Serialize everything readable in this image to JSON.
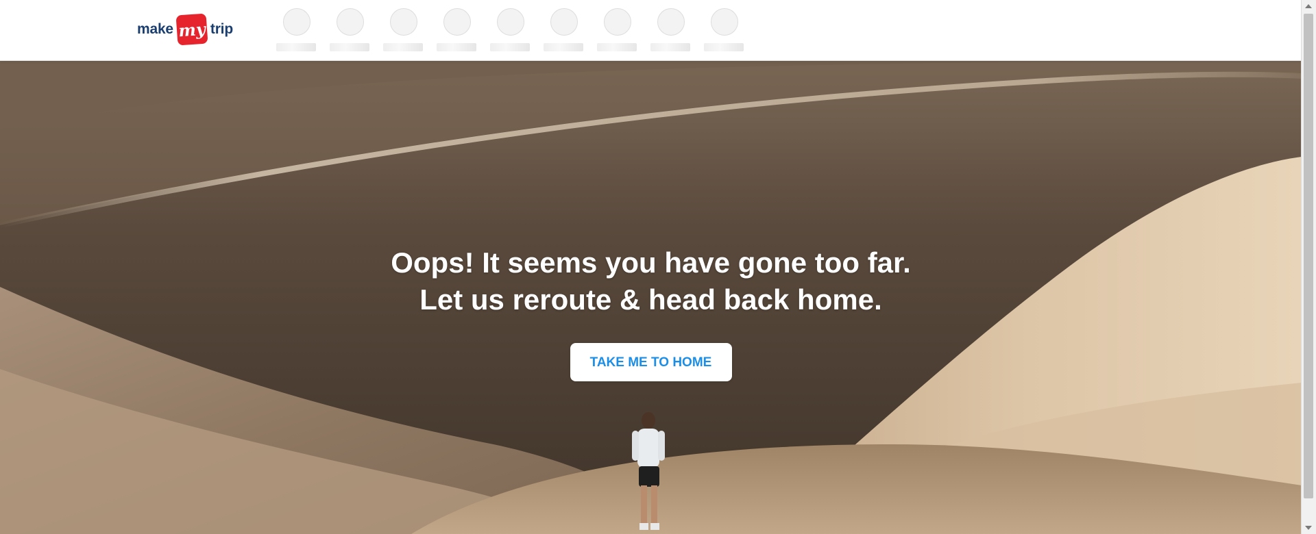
{
  "brand": {
    "left_text": "make",
    "badge_text": "my",
    "right_text": "trip",
    "badge_color": "#e5242d",
    "text_color": "#1a3e6f"
  },
  "nav_placeholders": [
    {
      "icon": "skeleton-circle"
    },
    {
      "icon": "skeleton-circle"
    },
    {
      "icon": "skeleton-circle"
    },
    {
      "icon": "skeleton-circle"
    },
    {
      "icon": "skeleton-circle"
    },
    {
      "icon": "skeleton-circle"
    },
    {
      "icon": "skeleton-circle"
    },
    {
      "icon": "skeleton-circle"
    },
    {
      "icon": "skeleton-circle"
    }
  ],
  "hero": {
    "headline_line1": "Oops! It seems you have gone too far.",
    "headline_line2": "Let us reroute & head back home.",
    "cta_label": "TAKE ME TO HOME",
    "cta_color": "#1b8ee8",
    "background": "desert-dunes-with-hiker"
  }
}
